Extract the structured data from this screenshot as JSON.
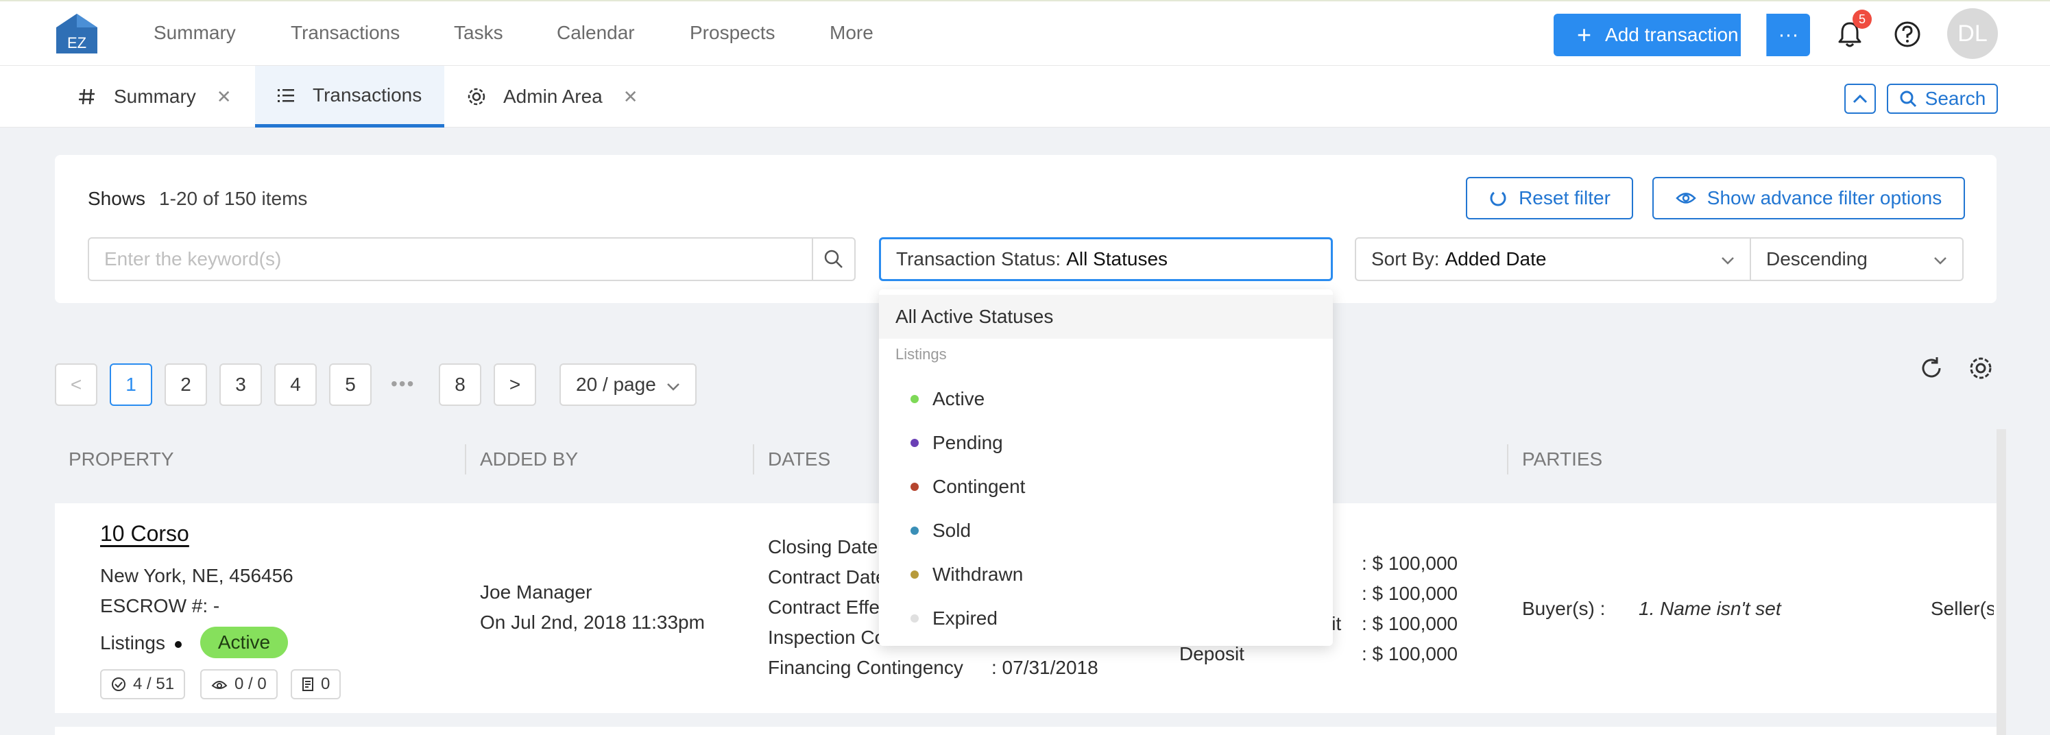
{
  "nav": {
    "logo_text": "EZ",
    "items": [
      "Summary",
      "Transactions",
      "Tasks",
      "Calendar",
      "Prospects",
      "More"
    ],
    "add_transaction": "Add transaction",
    "more_glyph": "···",
    "notifications": "5",
    "user_initials": "DL"
  },
  "tabs": [
    {
      "label": "Summary",
      "icon": "hash-icon"
    },
    {
      "label": "Transactions",
      "icon": "list-icon"
    },
    {
      "label": "Admin Area",
      "icon": "gear-icon"
    }
  ],
  "search_label": "Search",
  "filter": {
    "shows_label": "Shows",
    "range": "1-20 of 150 items",
    "reset": "Reset filter",
    "advanced": "Show advance filter options",
    "keyword_placeholder": "Enter the keyword(s)",
    "status_prefix": "Transaction Status:",
    "status_value": "All Statuses",
    "sort_prefix": "Sort By:",
    "sort_value": "Added Date",
    "order": "Descending"
  },
  "dropdown": {
    "selected": "All Active Statuses",
    "group": "Listings",
    "options": [
      {
        "label": "Active",
        "color": "#7ed957"
      },
      {
        "label": "Pending",
        "color": "#6a3fb5"
      },
      {
        "label": "Contingent",
        "color": "#b5452f"
      },
      {
        "label": "Sold",
        "color": "#3a8fb7"
      },
      {
        "label": "Withdrawn",
        "color": "#b79a3a"
      },
      {
        "label": "Expired",
        "color": "#e0e0e0"
      }
    ]
  },
  "pagination": {
    "prev": "<",
    "pages": [
      "1",
      "2",
      "3",
      "4",
      "5"
    ],
    "ellipsis": "•••",
    "last": "8",
    "next": ">",
    "page_size": "20 / page"
  },
  "table": {
    "headers": [
      "PROPERTY",
      "ADDED BY",
      "DATES",
      "PARTIES"
    ],
    "row": {
      "title": "10 Corso",
      "address": "New York, NE, 456456",
      "escrow": "ESCROW #: -",
      "type": "Listings",
      "status": "Active",
      "chips": [
        "4 / 51",
        "0 / 0",
        "0"
      ],
      "added_by": "Joe Manager",
      "added_on": "On Jul 2nd, 2018 11:33pm",
      "dates": [
        "Closing Date",
        "Contract Date",
        "Contract Effe",
        "Inspection Co",
        "Financing Contingency"
      ],
      "financing_date": ": 07/31/2018",
      "amounts": [
        ": $ 100,000",
        ": $ 100,000",
        ": $ 100,000",
        ": $ 100,000"
      ],
      "amount_label_credit": "lit",
      "amount_label_deposit": "Deposit",
      "buyer_label": "Buyer(s) :",
      "buyer_value": "1. Name isn't set",
      "seller_label": "Seller(s"
    }
  }
}
